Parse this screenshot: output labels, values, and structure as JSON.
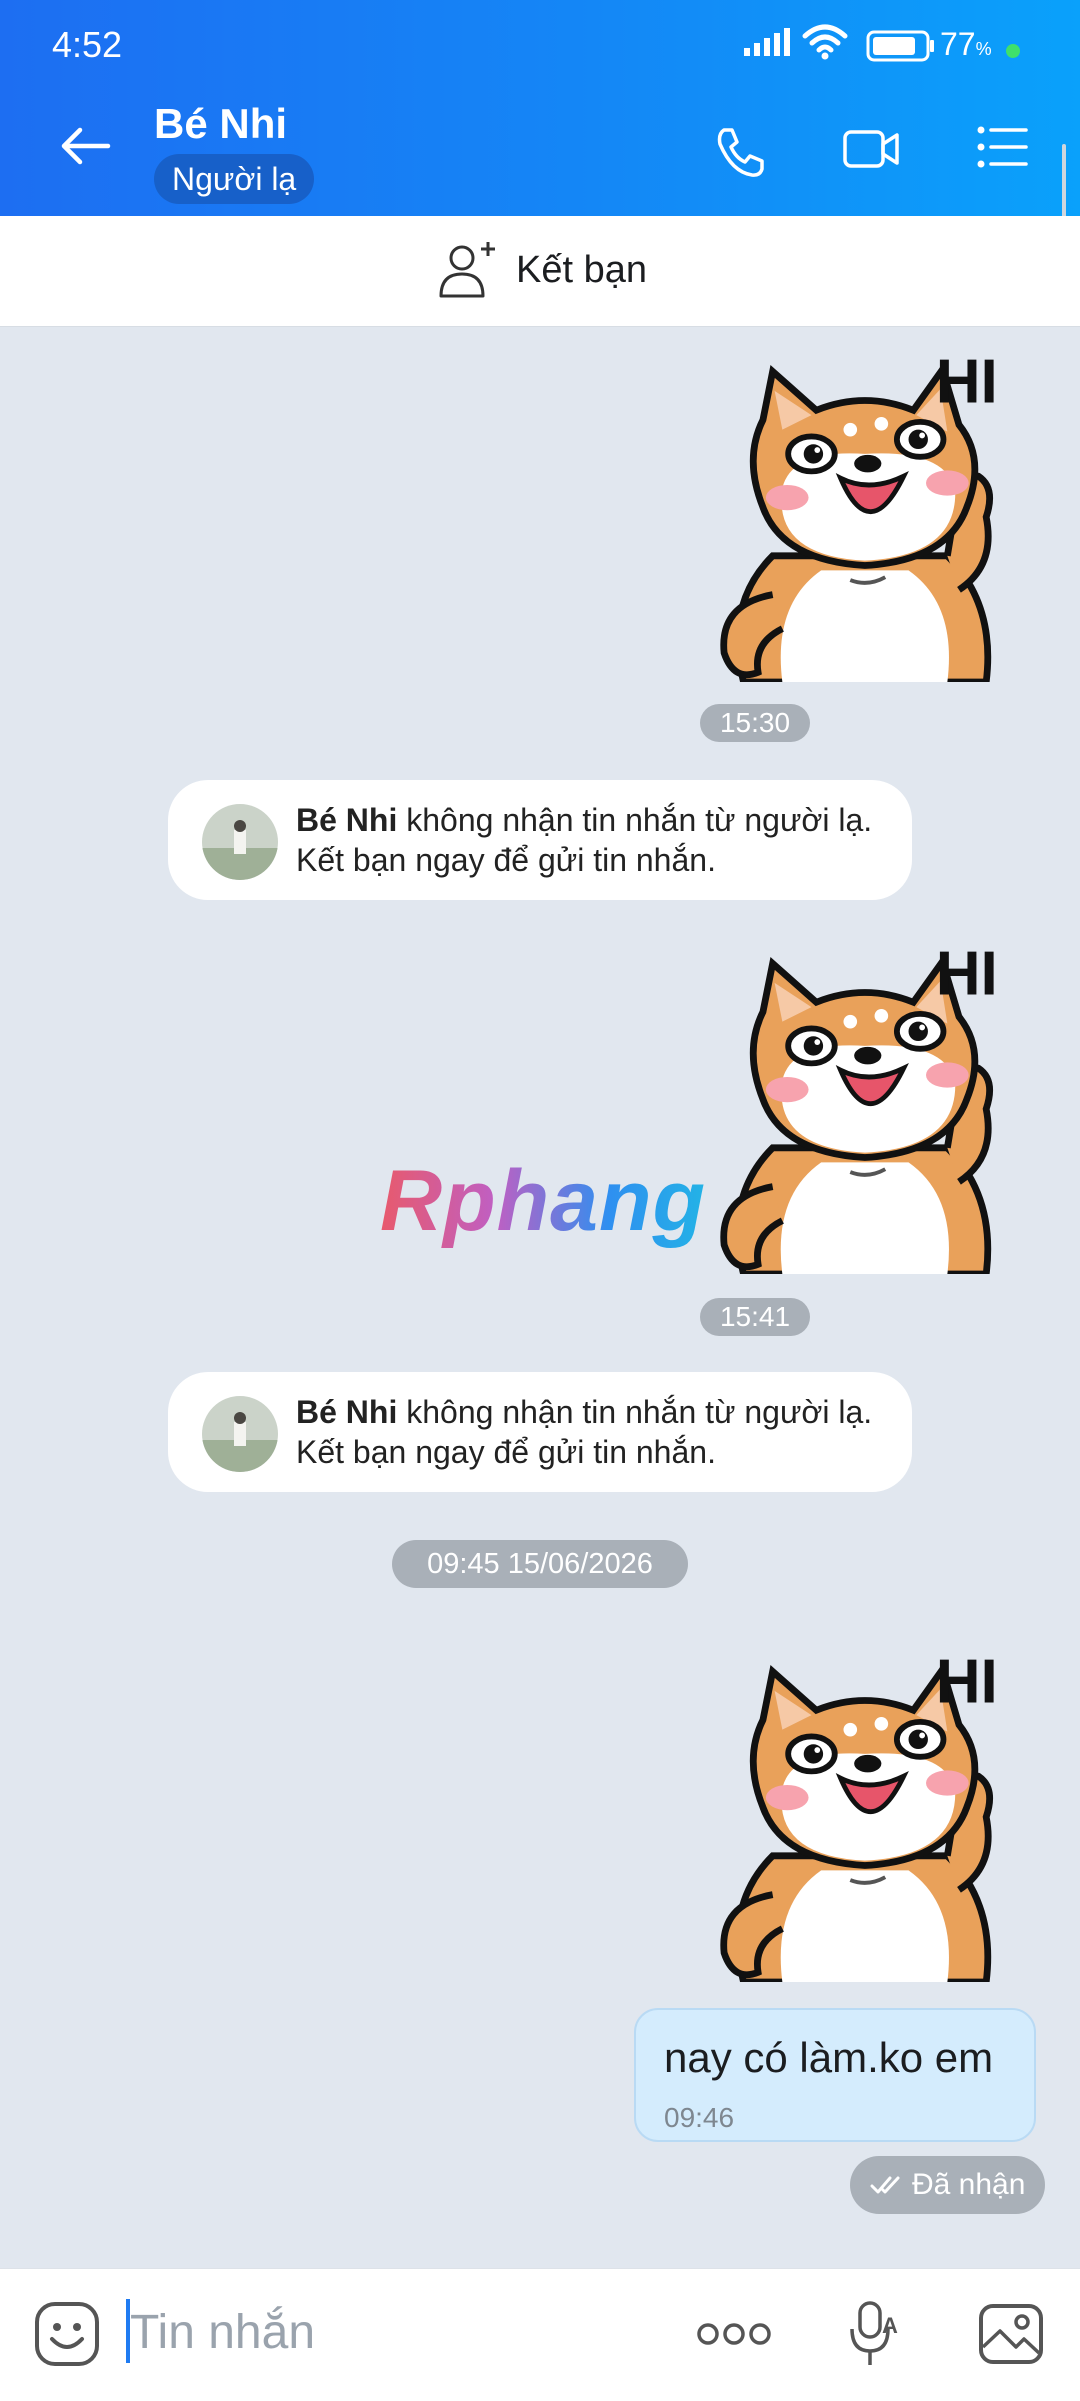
{
  "status_bar": {
    "time": "4:52",
    "battery": "77",
    "battery_unit": "%"
  },
  "header": {
    "contact_name": "Bé Nhi",
    "relationship_tag": "Người lạ"
  },
  "friend_bar": {
    "label": "Kết bạn"
  },
  "messages": {
    "time1": "15:30",
    "system1": {
      "name": "Bé Nhi",
      "line1": " không nhận tin nhắn từ người lạ.",
      "line2": "Kết bạn ngay để gửi tin nhắn."
    },
    "time2": "15:41",
    "system2": {
      "name": "Bé Nhi",
      "line1": " không nhận tin nhắn từ người lạ.",
      "line2": "Kết bạn ngay để gửi tin nhắn."
    },
    "date_divider": "09:45 15/06/2026",
    "text_message": "nay có làm.ko em",
    "text_time": "09:46",
    "status": "Đã nhận"
  },
  "sticker_text": "HI",
  "watermark": "Rphang",
  "input": {
    "placeholder": "Tin nhắn"
  },
  "colors": {
    "header": "#1487f6",
    "chat_bg": "#e1e7ef",
    "sent_bubble": "#d4ecfd",
    "pill": "#a9b0b8"
  }
}
